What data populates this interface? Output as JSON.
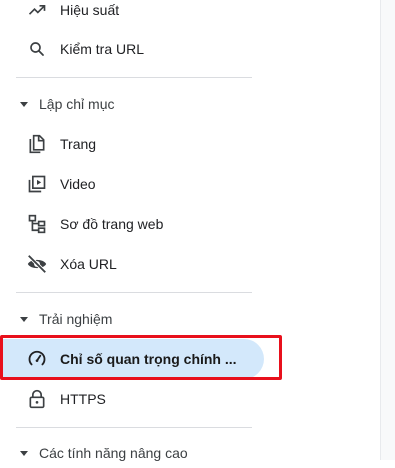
{
  "sidebar": {
    "performance": {
      "label": "Hiệu suất",
      "icon": "trending-up-icon"
    },
    "url_inspection": {
      "label": "Kiểm tra URL",
      "icon": "search-icon"
    },
    "indexing": {
      "label": "Lập chỉ mục",
      "items": [
        {
          "label": "Trang",
          "icon": "pages-icon"
        },
        {
          "label": "Video",
          "icon": "video-icon"
        },
        {
          "label": "Sơ đồ trang web",
          "icon": "sitemap-icon"
        },
        {
          "label": "Xóa URL",
          "icon": "visibility-off-icon"
        }
      ]
    },
    "experience": {
      "label": "Trải nghiệm",
      "items": [
        {
          "label": "Chỉ số quan trọng chính ...",
          "icon": "speed-gauge-icon",
          "selected": true
        },
        {
          "label": "HTTPS",
          "icon": "lock-icon"
        }
      ]
    },
    "enhancements": {
      "label": "Các tính năng nâng cao"
    }
  },
  "colors": {
    "selected_bg": "#d3e8fb",
    "highlight_border": "#e8101c",
    "divider": "#dadce0",
    "text": "#202124"
  }
}
